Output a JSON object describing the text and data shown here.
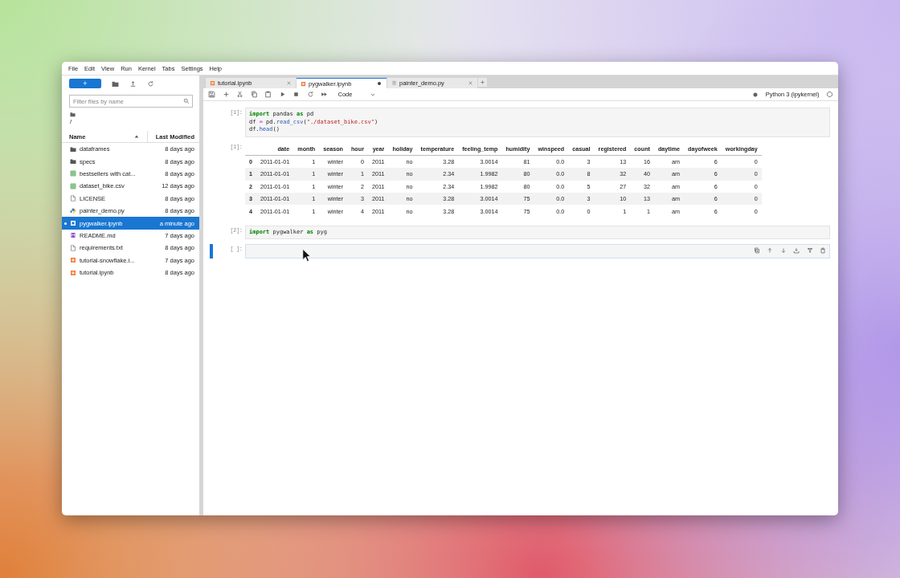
{
  "menu": [
    "File",
    "Edit",
    "View",
    "Run",
    "Kernel",
    "Tabs",
    "Settings",
    "Help"
  ],
  "sidebar": {
    "new_button": "+",
    "filter": {
      "placeholder": "Filter files by name"
    },
    "breadcrumb": "/",
    "columns": [
      {
        "label": "Name",
        "sorted": true
      },
      {
        "label": "Last Modified",
        "sorted": false
      }
    ],
    "files": [
      {
        "name": "dataframes",
        "modified": "8 days ago",
        "kind": "folder",
        "selected": false,
        "running": false
      },
      {
        "name": "specs",
        "modified": "8 days ago",
        "kind": "folder",
        "selected": false,
        "running": false
      },
      {
        "name": "bestsellers with cat...",
        "modified": "8 days ago",
        "kind": "csv",
        "selected": false,
        "running": false
      },
      {
        "name": "dataset_bike.csv",
        "modified": "12 days ago",
        "kind": "csv",
        "selected": false,
        "running": false
      },
      {
        "name": "LICENSE",
        "modified": "8 days ago",
        "kind": "file",
        "selected": false,
        "running": false
      },
      {
        "name": "painter_demo.py",
        "modified": "8 days ago",
        "kind": "python",
        "selected": false,
        "running": false
      },
      {
        "name": "pygwalker.ipynb",
        "modified": "a minute ago",
        "kind": "notebook",
        "selected": true,
        "running": true
      },
      {
        "name": "README.md",
        "modified": "7 days ago",
        "kind": "markdown",
        "selected": false,
        "running": false
      },
      {
        "name": "requirements.txt",
        "modified": "8 days ago",
        "kind": "file",
        "selected": false,
        "running": false
      },
      {
        "name": "tutorial-snowflake.i...",
        "modified": "7 days ago",
        "kind": "notebook",
        "selected": false,
        "running": false
      },
      {
        "name": "tutorial.ipynb",
        "modified": "8 days ago",
        "kind": "notebook",
        "selected": false,
        "running": false
      }
    ]
  },
  "tabs": [
    {
      "label": "tutorial.ipynb",
      "kind": "notebook",
      "selected": false,
      "unsaved": false
    },
    {
      "label": "pygwalker.ipynb",
      "kind": "notebook",
      "selected": true,
      "unsaved": true
    },
    {
      "label": "painter_demo.py",
      "kind": "file",
      "selected": false,
      "unsaved": false
    }
  ],
  "toolbar": {
    "cell_type": "Code",
    "kernel": "Python 3 (ipykernel)"
  },
  "cells": [
    {
      "kind": "code",
      "prompt": "[1]:",
      "active": false,
      "lines": [
        [
          {
            "t": "import",
            "kind": "kw"
          },
          {
            "t": " pandas ",
            "kind": "plain"
          },
          {
            "t": "as",
            "kind": "kw"
          },
          {
            "t": " pd",
            "kind": "plain"
          }
        ],
        [
          {
            "t": "df ",
            "kind": "plain"
          },
          {
            "t": "=",
            "kind": "op"
          },
          {
            "t": " pd.",
            "kind": "plain"
          },
          {
            "t": "read_csv",
            "kind": "fn"
          },
          {
            "t": "(",
            "kind": "plain"
          },
          {
            "t": "\"./dataset_bike.csv\"",
            "kind": "str"
          },
          {
            "t": ")",
            "kind": "plain"
          }
        ],
        [
          {
            "t": "df.",
            "kind": "plain"
          },
          {
            "t": "head",
            "kind": "fn"
          },
          {
            "t": "()",
            "kind": "plain"
          }
        ]
      ]
    },
    {
      "kind": "table",
      "prompt": "[1]:",
      "columns": [
        "date",
        "month",
        "season",
        "hour",
        "year",
        "holiday",
        "temperature",
        "feeling_temp",
        "humidity",
        "winspeed",
        "casual",
        "registered",
        "count",
        "daytime",
        "dayofweek",
        "workingday"
      ],
      "rows": [
        {
          "index": "0",
          "cells": [
            "2011-01-01",
            "1",
            "winter",
            "0",
            "2011",
            "no",
            "3.28",
            "3.0014",
            "81",
            "0.0",
            "3",
            "13",
            "16",
            "am",
            "6",
            "0"
          ]
        },
        {
          "index": "1",
          "cells": [
            "2011-01-01",
            "1",
            "winter",
            "1",
            "2011",
            "no",
            "2.34",
            "1.9982",
            "80",
            "0.0",
            "8",
            "32",
            "40",
            "am",
            "6",
            "0"
          ]
        },
        {
          "index": "2",
          "cells": [
            "2011-01-01",
            "1",
            "winter",
            "2",
            "2011",
            "no",
            "2.34",
            "1.9982",
            "80",
            "0.0",
            "5",
            "27",
            "32",
            "am",
            "6",
            "0"
          ]
        },
        {
          "index": "3",
          "cells": [
            "2011-01-01",
            "1",
            "winter",
            "3",
            "2011",
            "no",
            "3.28",
            "3.0014",
            "75",
            "0.0",
            "3",
            "10",
            "13",
            "am",
            "6",
            "0"
          ]
        },
        {
          "index": "4",
          "cells": [
            "2011-01-01",
            "1",
            "winter",
            "4",
            "2011",
            "no",
            "3.28",
            "3.0014",
            "75",
            "0.0",
            "0",
            "1",
            "1",
            "am",
            "6",
            "0"
          ]
        }
      ]
    },
    {
      "kind": "code",
      "prompt": "[2]:",
      "active": false,
      "lines": [
        [
          {
            "t": "import",
            "kind": "kw"
          },
          {
            "t": " pygwalker ",
            "kind": "plain"
          },
          {
            "t": "as",
            "kind": "kw"
          },
          {
            "t": " pyg",
            "kind": "plain"
          }
        ]
      ]
    },
    {
      "kind": "code",
      "prompt": "[ ]:",
      "active": true
    }
  ]
}
